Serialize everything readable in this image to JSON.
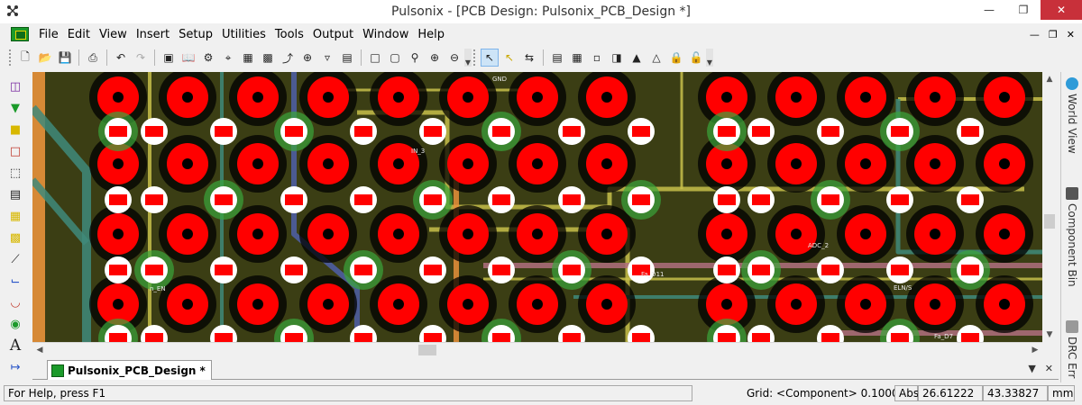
{
  "window": {
    "title": "Pulsonix - [PCB Design: Pulsonix_PCB_Design *]"
  },
  "menu": [
    "File",
    "Edit",
    "View",
    "Insert",
    "Setup",
    "Utilities",
    "Tools",
    "Output",
    "Window",
    "Help"
  ],
  "toolbar_icons": [
    "new-icon",
    "open-icon",
    "save-icon",
    "print-icon",
    "undo-icon",
    "redo-icon",
    "component-icon",
    "library-icon",
    "gear-icon",
    "find-icon",
    "select-net-icon",
    "hatch-icon",
    "route-icon",
    "crosshair-icon",
    "filter-icon",
    "report-icon",
    "zoom-window-icon",
    "zoom-previous-icon",
    "zoom-area-icon",
    "zoom-in-icon",
    "zoom-out-icon",
    "select-icon",
    "select-mode-icon",
    "swap-icon",
    "properties-icon",
    "spreadsheet-icon",
    "docs-icon",
    "layers-icon",
    "fix-icon",
    "unfix-icon",
    "lock-icon",
    "unlock-icon"
  ],
  "document_tab": {
    "label": "Pulsonix_PCB_Design",
    "modified": "*"
  },
  "side_panels": {
    "world_view": "World View",
    "component_bin": "Component Bin",
    "drc_errors": "DRC Err"
  },
  "status": {
    "help": "For Help, press F1",
    "grid": "Grid: <Component> 0.10000",
    "mode": "Abs",
    "x": "26.61222",
    "y": "43.33827",
    "units": "mm"
  },
  "pcb_labels": [
    "GND",
    "ADC_2",
    "ELN/S",
    "Fa_D11",
    "Fa_D7",
    "n_EN",
    "IN_3"
  ],
  "colors": {
    "board": "#3b3e14",
    "pad": "#ff0000",
    "pad_hole": "#000000",
    "smd_pad": "#ff0000",
    "smd_outline": "#ffffff",
    "track_orange": "#e8913a",
    "track_yellow": "#c8c04a",
    "track_teal": "#3f8a7a",
    "track_blue": "#4f5fa8",
    "track_pink": "#b06f7e",
    "close_button": "#c8303a"
  }
}
